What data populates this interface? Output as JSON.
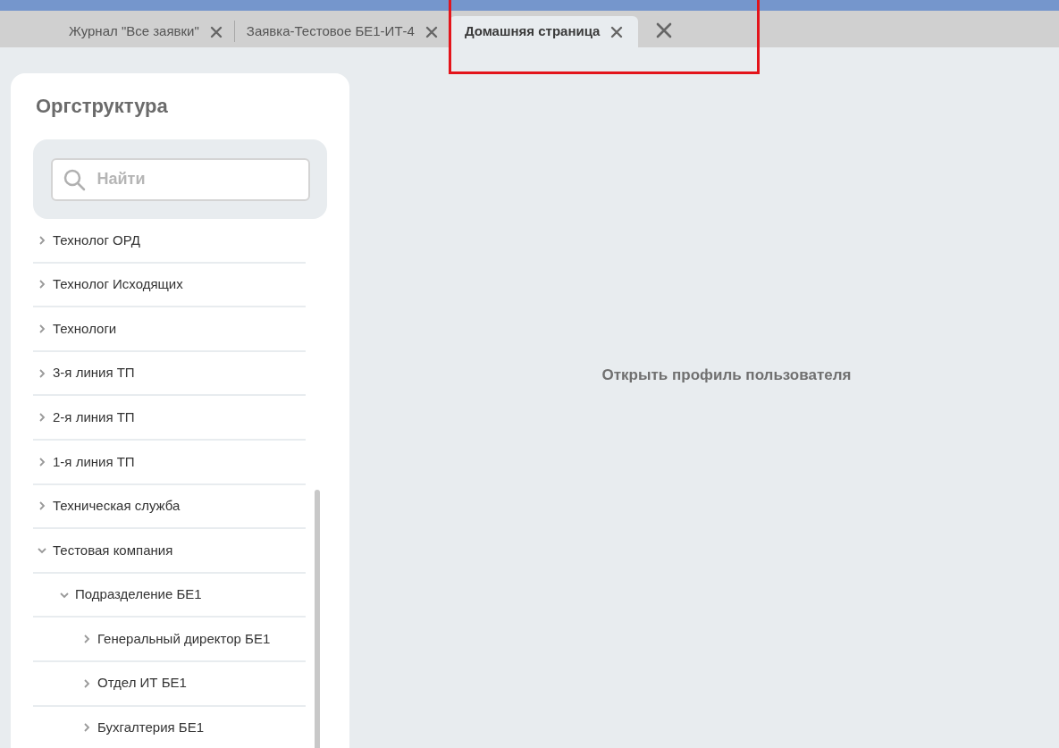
{
  "tabs": [
    {
      "label": "Журнал \"Все заявки\"",
      "selected": false
    },
    {
      "label": "Заявка-Тестовое БЕ1-ИТ-4",
      "selected": false
    },
    {
      "label": "Домашняя страница",
      "selected": true
    }
  ],
  "sidebar": {
    "title": "Оргструктура",
    "search": {
      "placeholder": "Найти"
    },
    "tree": [
      {
        "label": "Технолог ОРД",
        "expanded": false
      },
      {
        "label": "Технолог Исходящих",
        "expanded": false
      },
      {
        "label": "Технологи",
        "expanded": false
      },
      {
        "label": "3-я линия ТП",
        "expanded": false
      },
      {
        "label": "2-я линия ТП",
        "expanded": false
      },
      {
        "label": "1-я линия ТП",
        "expanded": false
      },
      {
        "label": "Техническая служба",
        "expanded": false
      },
      {
        "label": "Тестовая компания",
        "expanded": true,
        "children": [
          {
            "label": "Подразделение БЕ1",
            "expanded": true,
            "children": [
              {
                "label": "Генеральный директор БЕ1",
                "expanded": false
              },
              {
                "label": "Отдел ИТ БЕ1",
                "expanded": false
              },
              {
                "label": "Бухгалтерия БЕ1",
                "expanded": false
              }
            ]
          }
        ]
      }
    ]
  },
  "main": {
    "link": "Открыть профиль пользователя"
  }
}
